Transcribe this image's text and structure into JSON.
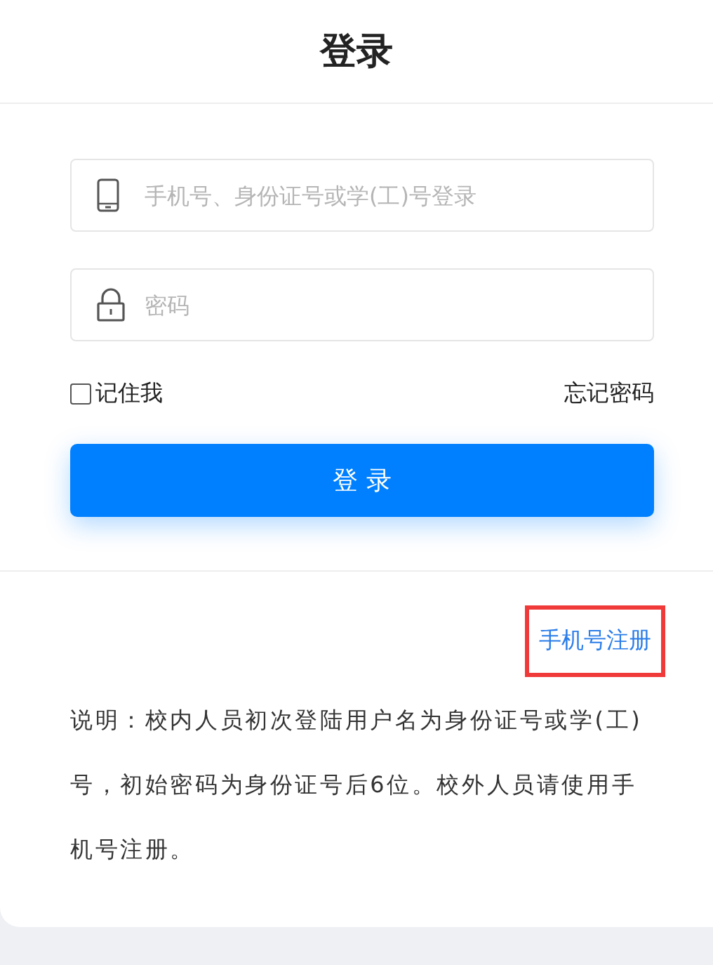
{
  "title": "登录",
  "fields": [
    {
      "kind": "phone",
      "placeholder": "手机号、身份证号或学(工)号登录"
    },
    {
      "kind": "lock",
      "placeholder": "密码"
    }
  ],
  "remember": {
    "label": "记住我",
    "checked": false
  },
  "forgot": "忘记密码",
  "login_button": "登 录",
  "register_link": {
    "label": "手机号注册",
    "highlighted": true
  },
  "note": "说明：校内人员初次登陆用户名为身份证号或学(工)号，初始密码为身份证号后6位。校外人员请使用手机号注册。"
}
